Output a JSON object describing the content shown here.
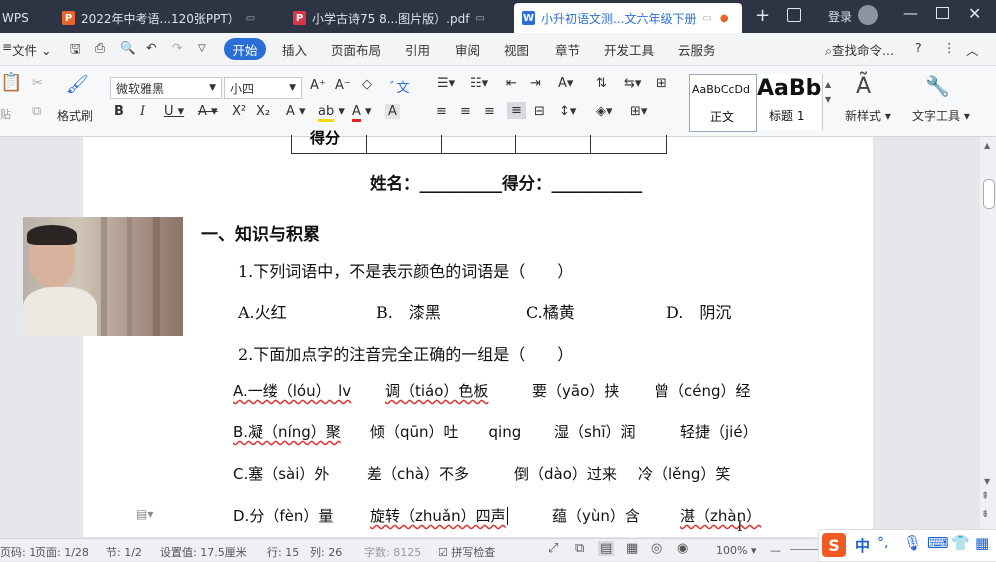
{
  "tabs": [
    {
      "label": "WPS"
    },
    {
      "label": "2022年中考语...120张PPT）"
    },
    {
      "label": "小学古诗75 8...图片版）.pdf"
    },
    {
      "label": "小升初语文测...文六年级下册"
    }
  ],
  "window": {
    "login": "登录"
  },
  "menu": {
    "file": "文件",
    "items": [
      "开始",
      "插入",
      "页面布局",
      "引用",
      "审阅",
      "视图",
      "章节",
      "开发工具",
      "云服务"
    ],
    "search": "查找命令..."
  },
  "ribbon": {
    "format_painter": "格式刷",
    "font_name": "微软雅黑",
    "font_size": "小四",
    "style_normal_preview": "AaBbCcDd",
    "style_normal": "正文",
    "style_h1_preview": "AaBb",
    "style_h1": "标题 1",
    "new_style": "新样式",
    "text_tool": "文字工具"
  },
  "document": {
    "score_header": "得分",
    "name_line": "姓名：__________得分：___________",
    "section_title": "一、知识与积累",
    "q1": "1.下列词语中，不是表示颜色的词语是（　　）",
    "q1_options": [
      "A.火红",
      "B.　漆黑",
      "C.橘黄",
      "D.　阴沉"
    ],
    "q2": "2.下面加点字的注音完全正确的一组是（　　）",
    "q2_rows": [
      [
        "A.一缕（lóu）　lv",
        "调（tiáo）色板",
        "要（yāo）挟",
        "曾（céng）经"
      ],
      [
        "B.凝（níng）聚",
        "倾（qūn）吐　　qing",
        "湿（shī）润",
        "轻捷（jié）"
      ],
      [
        "C.塞（sài）外",
        "差（chà）不多",
        "倒（dào）过来",
        "冷（lěng）笑"
      ],
      [
        "D.分（fèn）量",
        "旋转（zhuǎn）四声",
        "蕴（yùn）含",
        "湛（zhàn）"
      ]
    ]
  },
  "status": {
    "page_num": "页码: 1",
    "page": "页面: 1/28",
    "section": "节: 1/2",
    "setting": "设置值: 17.5厘米",
    "row": "行: 15",
    "col": "列: 26",
    "words": "字数: 8125",
    "spell": "拼写检查",
    "zoom": "100%"
  },
  "ime": {
    "lang": "中"
  }
}
